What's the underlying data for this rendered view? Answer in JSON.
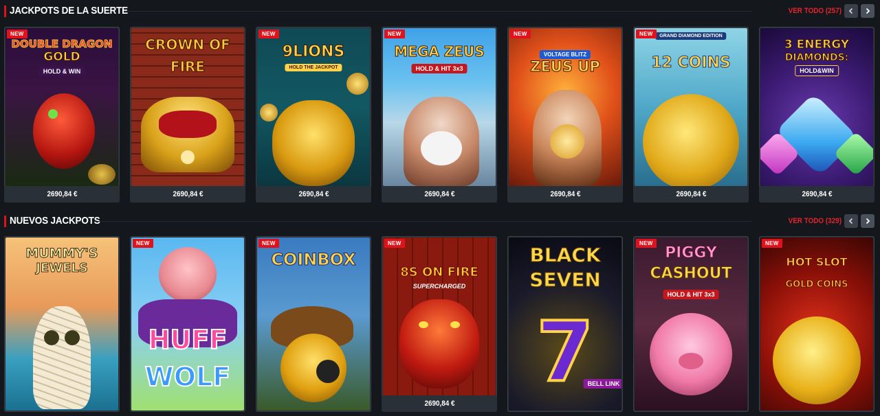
{
  "sections": [
    {
      "title": "JACKPOTS DE LA SUERTE",
      "view_all": "VER TODO (257)",
      "games": [
        {
          "name": "Double Dragon Gold",
          "title_line1": "DOUBLE DRAGON",
          "title_line2": "GOLD",
          "subtitle": "HOLD & WIN",
          "new": "NEW",
          "jackpot": "2690,84 €"
        },
        {
          "name": "Crown of Fire",
          "title_line1": "CROWN OF",
          "title_line2": "FIRE",
          "jackpot": "2690,84 €"
        },
        {
          "name": "9 Lions",
          "title_line1": "9LIONS",
          "subtitle": "HOLD THE JACKPOT",
          "new": "NEW",
          "jackpot": "2690,84 €"
        },
        {
          "name": "Mega Zeus",
          "title_line1": "MEGA ZEUS",
          "subtitle": "HOLD & HIT 3x3",
          "new": "NEW",
          "jackpot": "2690,84 €"
        },
        {
          "name": "Zeus Up",
          "title_line1": "ZEUS UP",
          "subtitle": "VOLTAGE BLITZ",
          "new": "NEW",
          "jackpot": "2690,84 €"
        },
        {
          "name": "12 Coins Grand Diamond Edition",
          "title_line1": "12 COINS",
          "subtitle": "GRAND DIAMOND EDITION",
          "new": "NEW",
          "jackpot": "2690,84 €"
        },
        {
          "name": "3 Energy Diamonds",
          "title_line1": "3 ENERGY",
          "title_line2": "DIAMONDS:",
          "subtitle": "HOLD&WIN",
          "jackpot": "2690,84 €"
        }
      ]
    },
    {
      "title": "NUEVOS JACKPOTS",
      "view_all": "VER TODO (329)",
      "games": [
        {
          "name": "Mummy's Jewels",
          "title_line1": "MUMMY'S",
          "title_line2": "JEWELS"
        },
        {
          "name": "Huff & Wolf",
          "title_line1": "HUFF",
          "title_line2": "WOLF",
          "new": "NEW"
        },
        {
          "name": "Coin Box",
          "title_line1": "COINBOX",
          "new": "NEW"
        },
        {
          "name": "8s On Fire Supercharged",
          "title_line1": "8S ON FIRE",
          "subtitle": "SUPERCHARGED",
          "new": "NEW",
          "jackpot": "2690,84 €"
        },
        {
          "name": "Black Seven",
          "title_line1": "BLACK",
          "title_line2": "SEVEN",
          "subtitle": "BELL LINK"
        },
        {
          "name": "Piggy Cashout",
          "title_line1": "PIGGY",
          "title_line2": "CASHOUT",
          "subtitle": "HOLD & HIT 3x3",
          "new": "NEW"
        },
        {
          "name": "Hot Slot Gold Coins",
          "title_line1": "HOT SLOT",
          "title_line2": "GOLD COINS",
          "new": "NEW"
        }
      ]
    }
  ],
  "colors": {
    "accent": "#e0121b",
    "view_all": "#e5242d",
    "background": "#14171c"
  },
  "icons": {
    "prev": "chevron-left-icon",
    "next": "chevron-right-icon"
  }
}
